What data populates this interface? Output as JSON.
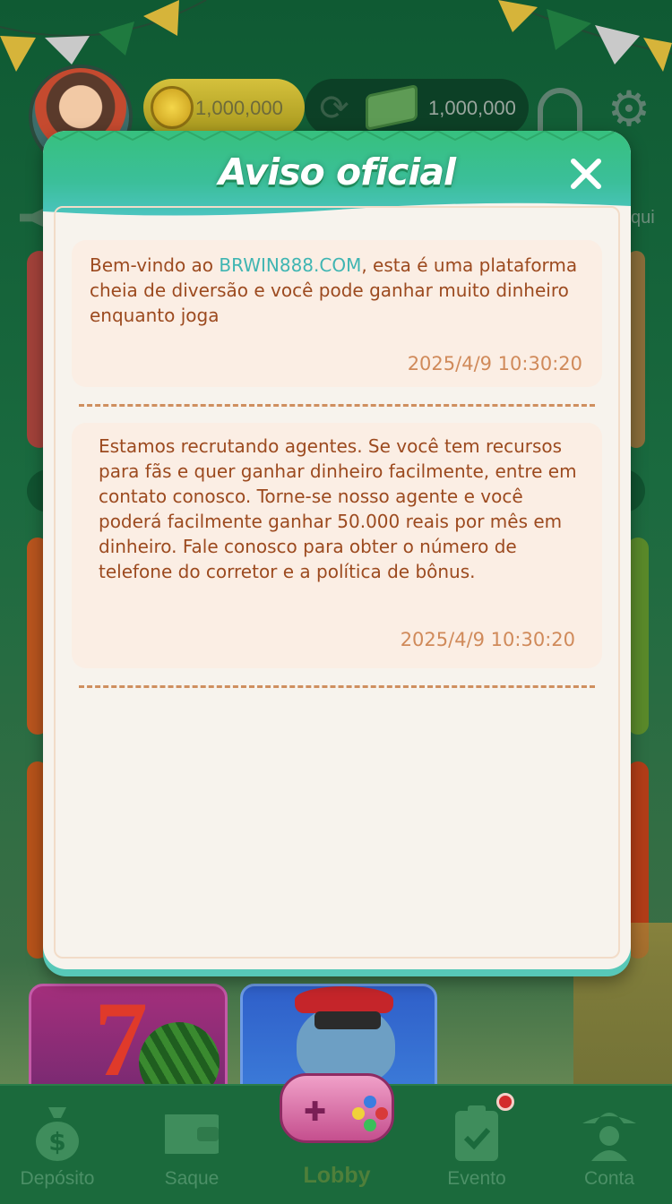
{
  "balance": {
    "coins": "1,000,000",
    "cash": "1,000,000"
  },
  "background_partial_text": "qui",
  "modal": {
    "title": "Aviso oficial",
    "notices": [
      {
        "text_before_link": "Bem-vindo ao ",
        "link": "BRWIN888.COM",
        "text_after_link": ", esta é uma plataforma cheia de diversão e você pode ganhar muito dinheiro enquanto joga",
        "timestamp": "2025/4/9 10:30:20"
      },
      {
        "text": "Estamos recrutando agentes. Se você tem recursos para fãs e quer ganhar dinheiro facilmente, entre em contato conosco. Torne-se nosso agente e você poderá facilmente ganhar 50.000 reais por mês em dinheiro. Fale conosco para obter o número de telefone do corretor e a política de bônus.",
        "timestamp": "2025/4/9 10:30:20"
      }
    ]
  },
  "bottom_nav": {
    "items": [
      {
        "label": "Depósito",
        "icon": "money-bag-icon"
      },
      {
        "label": "Saque",
        "icon": "wallet-icon"
      },
      {
        "label": "Lobby",
        "icon": "gamepad-icon",
        "active": true
      },
      {
        "label": "Evento",
        "icon": "clipboard-check-icon",
        "has_notification": true
      },
      {
        "label": "Conta",
        "icon": "sombrero-user-icon"
      }
    ]
  },
  "colors": {
    "header_green": "#37c07e",
    "header_teal": "#4cc4c0",
    "notice_text": "#9c4a1f",
    "link": "#3fb5b2",
    "timestamp": "#d08a5a",
    "nav_bg": "#1b6a3c"
  }
}
